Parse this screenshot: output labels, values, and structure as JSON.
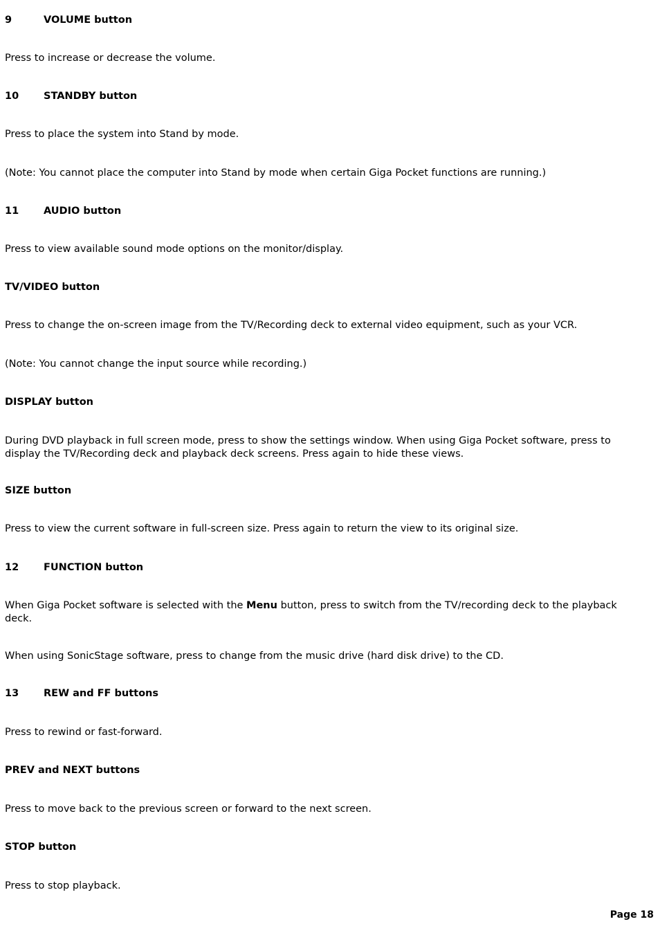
{
  "document": {
    "page_label": "Page 18",
    "background_color": "#ffffff",
    "text_color": "#000000"
  },
  "sections": [
    {
      "number": "9",
      "heading": "VOLUME button",
      "body": [
        "Press to increase or decrease the volume."
      ]
    },
    {
      "number": "10",
      "heading": "STANDBY button",
      "body": [
        "Press to place the system into Stand by mode.",
        "(Note: You cannot place the computer into Stand by mode when certain Giga Pocket functions are running.)"
      ]
    },
    {
      "number": "11",
      "heading": "AUDIO button",
      "body": [
        "Press to view available sound mode options on the monitor/display."
      ]
    },
    {
      "number": "",
      "heading": "TV/VIDEO button",
      "body": [
        "Press to change the on-screen image from the TV/Recording deck to external video equipment, such as your VCR.",
        "(Note: You cannot change the input source while recording.)"
      ]
    },
    {
      "number": "",
      "heading": "DISPLAY button",
      "body": [
        "During DVD playback in full screen mode, press to show the settings window. When using Giga Pocket software, press to display the TV/Recording deck and playback deck screens. Press again to hide these views."
      ]
    },
    {
      "number": "",
      "heading": "SIZE button",
      "body": [
        "Press to view the current software in full-screen size. Press again to return the view to its original size."
      ]
    },
    {
      "number": "12",
      "heading": "FUNCTION button",
      "body": [
        "When Giga Pocket software is selected with the Menu button, press to switch from the TV/recording deck to the playback deck.",
        "When using SonicStage software, press to change from the music drive (hard disk drive) to the CD."
      ],
      "inline_bold": "Menu"
    },
    {
      "number": "13",
      "heading": "REW and FF buttons",
      "body": [
        "Press to rewind or fast-forward."
      ]
    },
    {
      "number": "",
      "heading": "PREV and NEXT buttons",
      "body": [
        "Press to move back to the previous screen or forward to the next screen."
      ]
    },
    {
      "number": "",
      "heading": "STOP button",
      "body": [
        "Press to stop playback."
      ]
    }
  ],
  "function_paragraph_parts": {
    "before": "When Giga Pocket software is selected with the ",
    "bold": "Menu",
    "after": " button, press to switch from the TV/recording deck to the playback deck."
  }
}
